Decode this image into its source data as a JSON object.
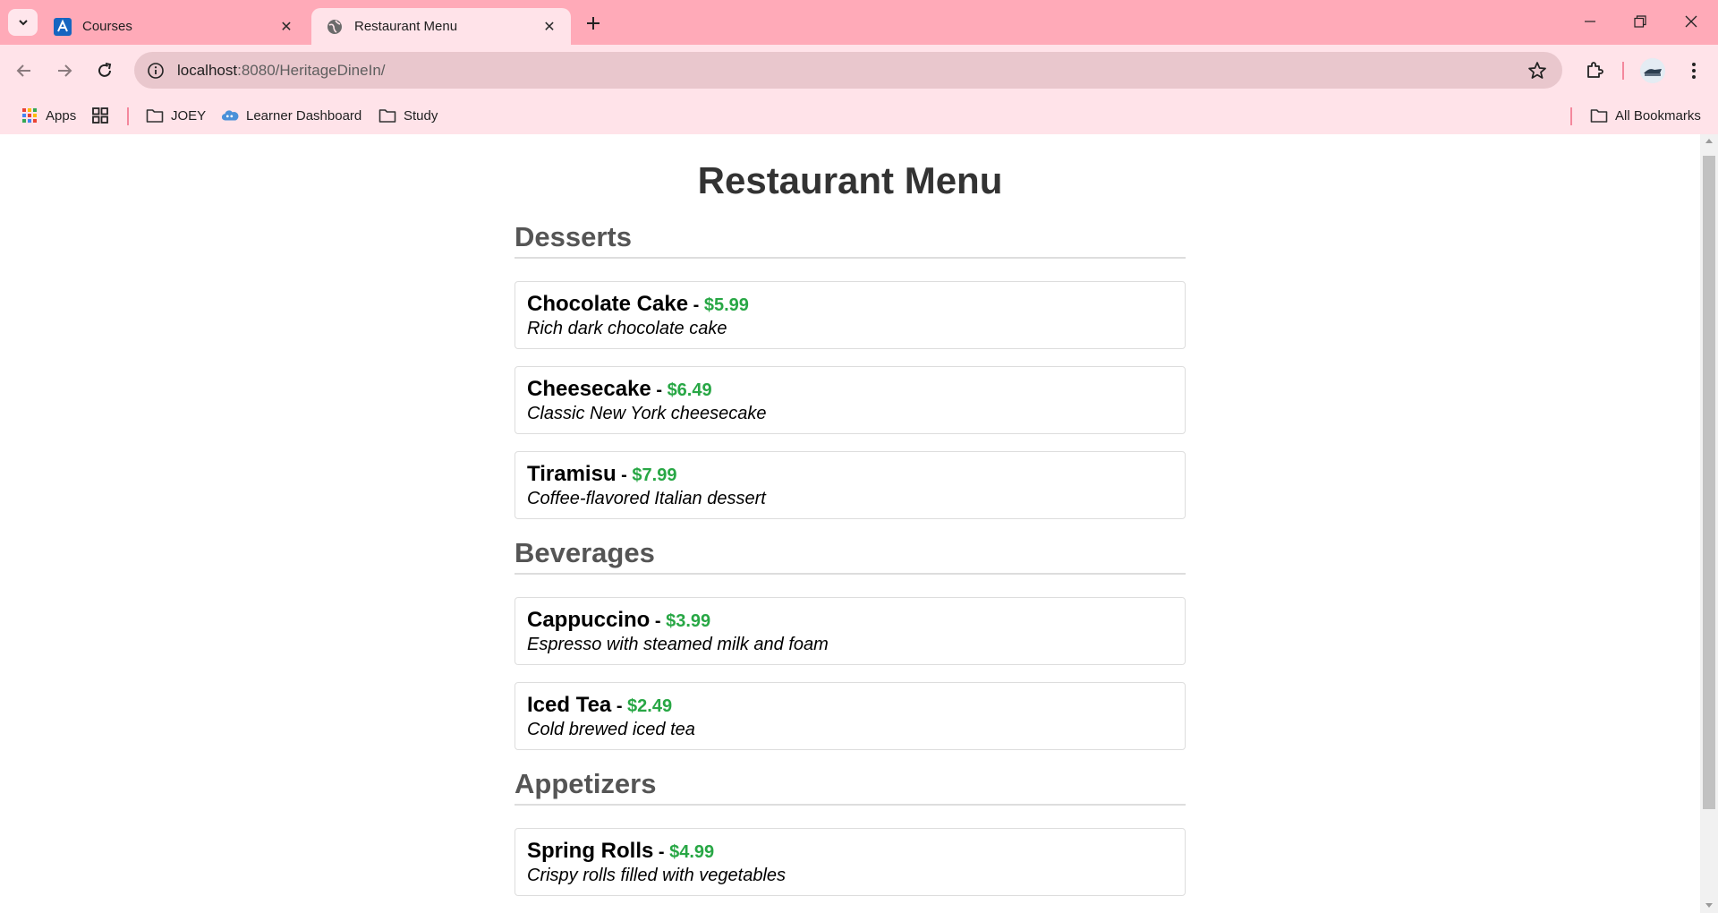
{
  "browser": {
    "tabs": [
      {
        "title": "Courses",
        "active": false
      },
      {
        "title": "Restaurant Menu",
        "active": true
      }
    ],
    "url_host": "localhost",
    "url_path": ":8080/HeritageDineIn/",
    "bookmarks": [
      {
        "label": "Apps",
        "icon": "apps-grid-icon"
      },
      {
        "label": "",
        "icon": "tab-groups-icon"
      },
      {
        "label": "JOEY",
        "icon": "folder-icon"
      },
      {
        "label": "Learner Dashboard",
        "icon": "cloud-icon"
      },
      {
        "label": "Study",
        "icon": "folder-icon"
      }
    ],
    "all_bookmarks": "All Bookmarks"
  },
  "page": {
    "title": "Restaurant Menu",
    "categories": [
      {
        "name": "Desserts",
        "items": [
          {
            "name": "Chocolate Cake",
            "price": "$5.99",
            "description": "Rich dark chocolate cake"
          },
          {
            "name": "Cheesecake",
            "price": "$6.49",
            "description": "Classic New York cheesecake"
          },
          {
            "name": "Tiramisu",
            "price": "$7.99",
            "description": "Coffee-flavored Italian dessert"
          }
        ]
      },
      {
        "name": "Beverages",
        "items": [
          {
            "name": "Cappuccino",
            "price": "$3.99",
            "description": "Espresso with steamed milk and foam"
          },
          {
            "name": "Iced Tea",
            "price": "$2.49",
            "description": "Cold brewed iced tea"
          }
        ]
      },
      {
        "name": "Appetizers",
        "items": [
          {
            "name": "Spring Rolls",
            "price": "$4.99",
            "description": "Crispy rolls filled with vegetables"
          }
        ]
      }
    ],
    "separator": " - "
  },
  "colors": {
    "tabstrip": "#ffaab8",
    "toolbar": "#ffe3e9",
    "price": "#28a745",
    "heading": "#333333",
    "category": "#555555"
  }
}
